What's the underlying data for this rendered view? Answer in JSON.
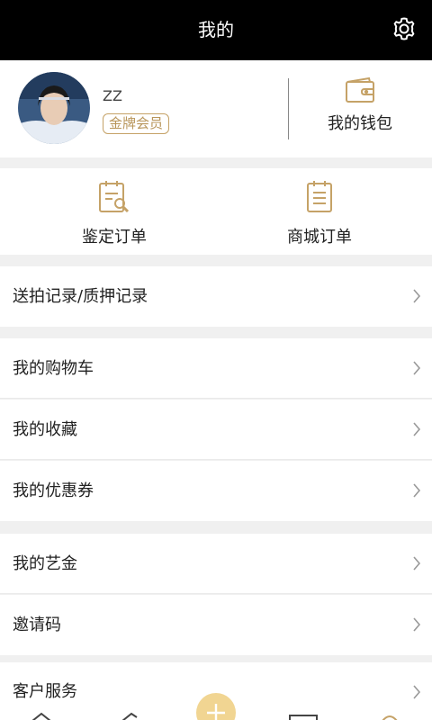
{
  "header": {
    "title": "我的"
  },
  "profile": {
    "username": "ZZ",
    "badge": "金牌会员",
    "wallet_label": "我的钱包"
  },
  "orders": [
    {
      "label": "鉴定订单"
    },
    {
      "label": "商城订单"
    }
  ],
  "menu": {
    "record": "送拍记录/质押记录",
    "cart": "我的购物车",
    "favorites": "我的收藏",
    "coupons": "我的优惠券",
    "art_gold": "我的艺金",
    "invite": "邀请码",
    "service": "客户服务"
  },
  "colors": {
    "header_bg": "#000000",
    "accent_gold": "#c5a267",
    "fab_yellow": "#f1d592"
  }
}
